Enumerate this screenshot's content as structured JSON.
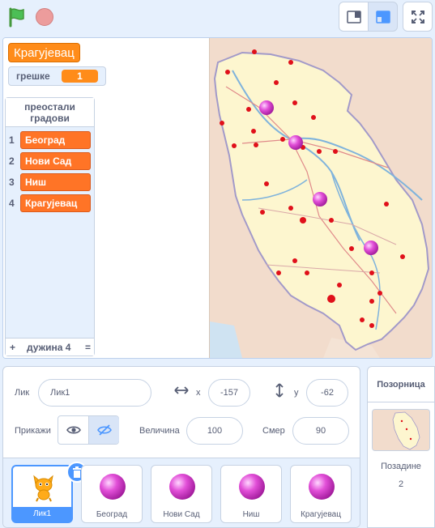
{
  "toolbar": {
    "green_flag_icon": "green-flag-icon",
    "stop_icon": "stop-icon",
    "small_stage_icon": "small-stage-icon",
    "large_stage_icon": "large-stage-icon",
    "fullscreen_icon": "fullscreen-icon"
  },
  "stage": {
    "current_city": "Крагујевац",
    "errors_label": "грешке",
    "errors_value": "1",
    "list": {
      "title": "преостали градови",
      "items": [
        {
          "index": "1",
          "value": "Београд"
        },
        {
          "index": "2",
          "value": "Нови Сад"
        },
        {
          "index": "3",
          "value": "Ниш"
        },
        {
          "index": "4",
          "value": "Крагујевац"
        }
      ],
      "add_symbol": "+",
      "length_label": "дужина 4",
      "resize_symbol": "="
    },
    "map": {
      "description_icon": "serbia-map",
      "colors": {
        "land": "#fdf6cf",
        "outside": "#f2dccc",
        "border": "#a29ac9",
        "rivers": "#7fb3dc",
        "dots": "#e0101a",
        "pink_ball": "#e24fd8"
      }
    }
  },
  "sprite_info": {
    "sprite_label": "Лик",
    "sprite_name": "Лик1",
    "x_label": "x",
    "x_value": "-157",
    "y_label": "y",
    "y_value": "-62",
    "show_label": "Прикажи",
    "size_label": "Величина",
    "size_value": "100",
    "direction_label": "Смер",
    "direction_value": "90"
  },
  "sprites": [
    {
      "name": "Лик1",
      "icon": "cat-sprite-icon",
      "selected": true
    },
    {
      "name": "Београд",
      "icon": "pink-ball-icon",
      "selected": false
    },
    {
      "name": "Нови Сад",
      "icon": "pink-ball-icon",
      "selected": false
    },
    {
      "name": "Ниш",
      "icon": "pink-ball-icon",
      "selected": false
    },
    {
      "name": "Крагујевац",
      "icon": "pink-ball-icon",
      "selected": false
    }
  ],
  "stage_pane": {
    "title": "Позорница",
    "backdrops_label": "Позадине",
    "backdrops_count": "2"
  }
}
